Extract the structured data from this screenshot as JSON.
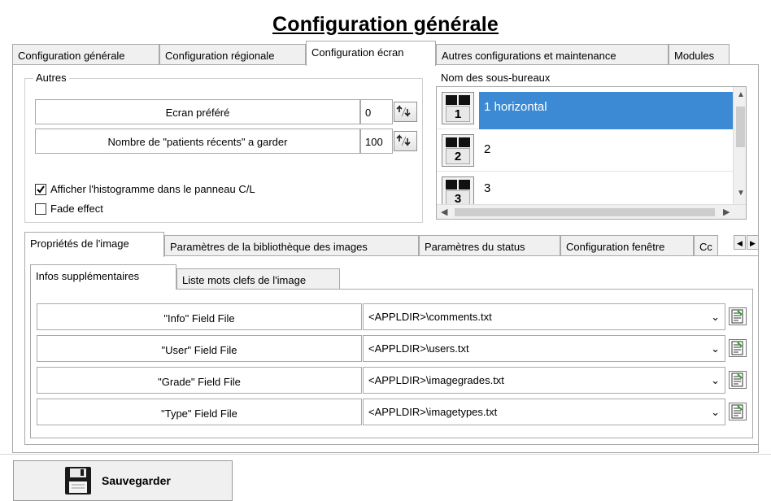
{
  "page_title": "Configuration générale",
  "top_tabs": [
    {
      "label": "Configuration générale"
    },
    {
      "label": "Configuration régionale"
    },
    {
      "label": "Configuration écran"
    },
    {
      "label": "Autres configurations et maintenance"
    },
    {
      "label": "Modules"
    }
  ],
  "autres": {
    "label": "Autres",
    "ecran_prefere": {
      "label": "Ecran préféré",
      "value": "0"
    },
    "patients_recents": {
      "label": "Nombre de \"patients récents\" a garder",
      "value": "100"
    },
    "histogram_checkbox": {
      "label": "Afficher l'histogramme dans le panneau C/L",
      "checked": true
    },
    "fade_checkbox": {
      "label": "Fade effect",
      "checked": false
    }
  },
  "sous_bureaux": {
    "label": "Nom des sous-bureaux",
    "items": [
      {
        "label": "1 horizontal",
        "icon_number": "1",
        "selected": true
      },
      {
        "label": "2",
        "icon_number": "2",
        "selected": false
      },
      {
        "label": "3",
        "icon_number": "3",
        "selected": false
      }
    ]
  },
  "sub_tabs": [
    {
      "label": "Propriétés de l'image"
    },
    {
      "label": "Paramètres de la bibliothèque des images"
    },
    {
      "label": "Paramètres du status"
    },
    {
      "label": "Configuration fenêtre"
    },
    {
      "label": "Cc"
    }
  ],
  "subsub_tabs": [
    {
      "label": "Infos supplémentaires"
    },
    {
      "label": "Liste mots clefs de l'image"
    }
  ],
  "field_files": [
    {
      "label": "\"Info\" Field File",
      "value": "<APPLDIR>\\comments.txt"
    },
    {
      "label": "\"User\" Field File",
      "value": "<APPLDIR>\\users.txt"
    },
    {
      "label": "\"Grade\" Field File",
      "value": "<APPLDIR>\\imagegrades.txt"
    },
    {
      "label": "\"Type\" Field File",
      "value": "<APPLDIR>\\imagetypes.txt"
    }
  ],
  "save_button": {
    "label": "Sauvegarder"
  },
  "colors": {
    "selection": "#3b8ad3",
    "tab_bg": "#f0f0f0",
    "border": "#a9a9a9"
  }
}
